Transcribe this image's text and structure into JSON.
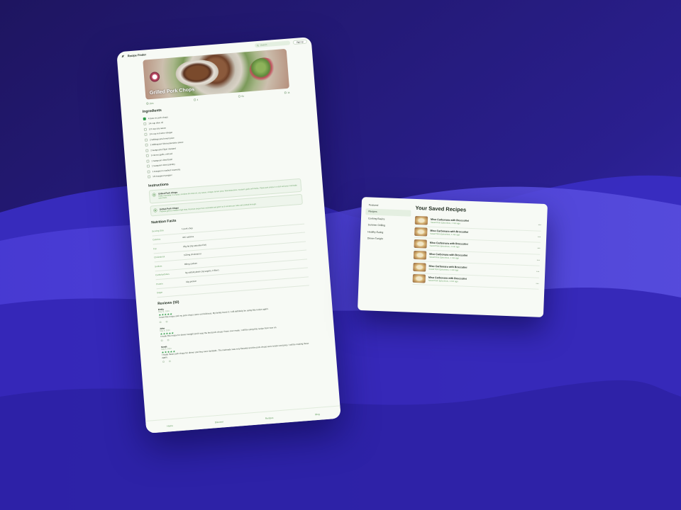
{
  "colors": {
    "background": "#2a1f8f",
    "accent": "#2f9a48",
    "surface": "#f7faf5",
    "muted_green": "#6aa266"
  },
  "recipe_app": {
    "app_name": "Recipe Finder",
    "search_placeholder": "Search",
    "signup_label": "Sign up",
    "hero_title": "Grilled Pork Chops",
    "stats": [
      {
        "icon": "clock-icon",
        "value": "15m"
      },
      {
        "icon": "servings-icon",
        "value": "4"
      },
      {
        "icon": "difficulty-icon",
        "value": "Ez"
      },
      {
        "icon": "calories-icon",
        "value": "1k"
      }
    ],
    "ingredients_heading": "Ingredients",
    "ingredients": [
      {
        "text": "4 bone-in pork chops",
        "checked": true
      },
      {
        "text": "1/4 cup olive oil",
        "checked": false
      },
      {
        "text": "1/2 cup soy sauce",
        "checked": false
      },
      {
        "text": "1/4 cup red wine vinegar",
        "checked": false
      },
      {
        "text": "2 tablespoons lemon juice",
        "checked": false
      },
      {
        "text": "1 tablespoon Worcestershire sauce",
        "checked": false
      },
      {
        "text": "2 teaspoons Dijon mustard",
        "checked": false
      },
      {
        "text": "3 cloves garlic, minced",
        "checked": false
      },
      {
        "text": "1 teaspoon dried basil",
        "checked": false
      },
      {
        "text": "1 teaspoon dried parsley",
        "checked": false
      },
      {
        "text": "1 teaspoon crushed rosemary",
        "checked": false
      },
      {
        "text": "1/2 teaspoon pepper",
        "checked": false
      }
    ],
    "instructions_heading": "Instructions",
    "instructions": [
      {
        "title": "Grilled Pork Chops",
        "text": "Make marinade: In a bowl, combine the olive oil, soy sauce, vinegar, lemon juice, Worcestershire, mustard, garlic and herbs. Place pork chops in a dish and pour marinade over them."
      },
      {
        "title": "Grilled Pork Chops",
        "text": "Preheat grill for medium-high heat. Remove chops from marinade and grill 6 to 8 minutes per side until cooked through."
      }
    ],
    "nutrition_heading": "Nutrition Facts",
    "nutrition": [
      {
        "label": "Serving Size",
        "value": "1 pork chop"
      },
      {
        "label": "Calories",
        "value": "446 calories"
      },
      {
        "label": "Fat",
        "value": "35g fat (5g saturated fat)"
      },
      {
        "label": "Cholesterol",
        "value": "103mg cholesterol"
      },
      {
        "label": "Sodium",
        "value": "88mg sodium"
      },
      {
        "label": "Carbohydrates",
        "value": "3g carbohydrate (1g sugars, 0 fiber)"
      },
      {
        "label": "Protein",
        "value": "31g protein"
      },
      {
        "label": "Sugar",
        "value": ""
      }
    ],
    "reviews_heading": "Reviews (32)",
    "reviews": [
      {
        "name": "Emily",
        "date": "May 11, 2023",
        "stars": "★★★★★",
        "text": "I used this recipe and my pork chops came out delicious. My family loved it. I will definitely be using this recipe again."
      },
      {
        "name": "John",
        "date": "May 8, 2023",
        "stars": "★★★★★",
        "text": "I made this recipe for dinner tonight and it was the best pork chops I have ever made. I will be using this recipe from now on."
      },
      {
        "name": "Sarah",
        "date": "May 6, 2023",
        "stars": "★★★★★",
        "text": "I made these pork chops for dinner and they were fantastic. The marinade was very flavorful and the pork chops were tender and juicy. I will be making these again."
      }
    ],
    "bottom_nav": [
      "Home",
      "Discover",
      "Recipes",
      "Blog"
    ]
  },
  "saved_card": {
    "title": "Your Saved Recipes",
    "sidebar": [
      {
        "label": "Featured",
        "active": false
      },
      {
        "label": "Recipes",
        "active": true
      },
      {
        "label": "Cooking Basics",
        "active": false
      },
      {
        "label": "Summer Grilling",
        "active": false
      },
      {
        "label": "Healthy Eating",
        "active": false
      },
      {
        "label": "Dinner Tonight",
        "active": false
      }
    ],
    "items": [
      {
        "name": "Miso Carbonara with Broccolini",
        "sub": "Saved from Epicurious, 1 min ago",
        "more": "•••"
      },
      {
        "name": "Miso Carbonara with Broccolini",
        "sub": "Saved from Epicurious, 1 min ago",
        "more": "•••"
      },
      {
        "name": "Miso Carbonara with Broccolini",
        "sub": "Saved from Epicurious, 1 min ago",
        "more": "•••"
      },
      {
        "name": "Miso Carbonara with Broccolini",
        "sub": "Saved from Epicurious, 1 min ago",
        "more": "•••"
      },
      {
        "name": "Miso Carbonara with Broccolini",
        "sub": "Saved from Epicurious, 1 min ago",
        "more": "•••"
      },
      {
        "name": "Miso Carbonara with Broccolini",
        "sub": "Saved from Epicurious, 1 min ago",
        "more": "•••"
      }
    ]
  }
}
